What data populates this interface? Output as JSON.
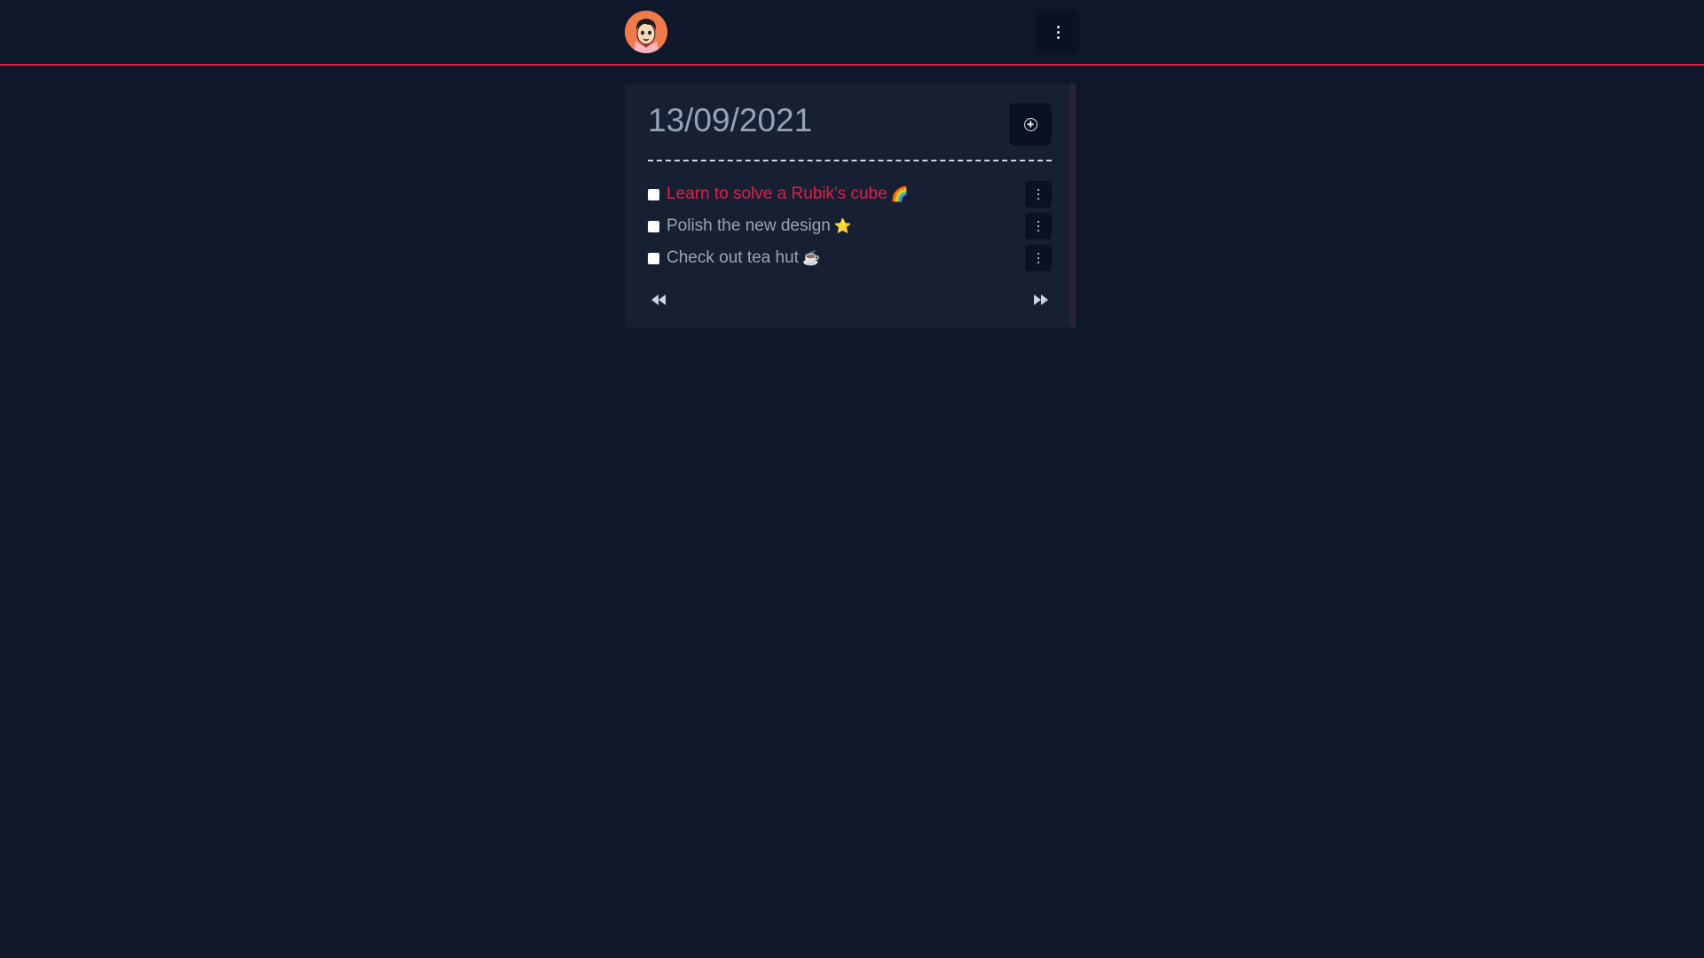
{
  "header": {
    "avatar_icon": "cartoon-boy-avatar",
    "menu_icon": "vertical-dots-icon",
    "accent_color": "#e11d48",
    "avatar_color": "#f07a4a"
  },
  "card": {
    "date": "13/09/2021",
    "add_icon": "plus-circle-icon",
    "tasks": [
      {
        "label": "Learn to solve a Rubik's cube",
        "emoji": "🌈",
        "checked": false,
        "highlighted": true
      },
      {
        "label": "Polish the new design",
        "emoji": "⭐",
        "checked": false,
        "highlighted": false
      },
      {
        "label": "Check out tea hut",
        "emoji": "☕",
        "checked": false,
        "highlighted": false
      }
    ],
    "prev_icon": "rewind-icon",
    "next_icon": "fast-forward-icon"
  },
  "colors": {
    "background": "#0f172a",
    "card": "#172033",
    "muted_text": "#94a3b8",
    "highlight_text": "#e11d48"
  }
}
